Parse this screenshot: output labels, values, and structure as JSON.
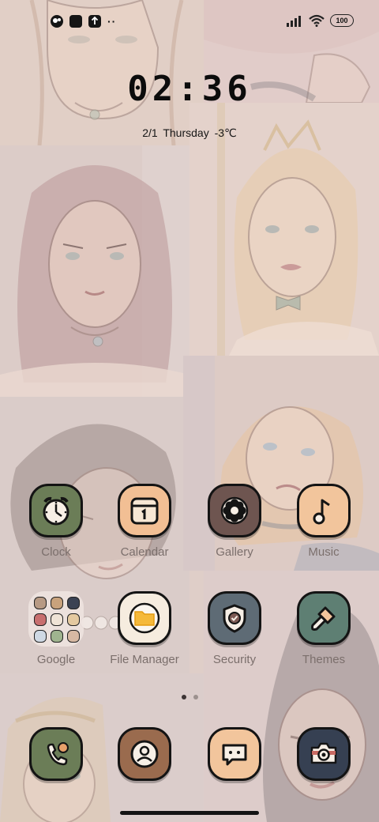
{
  "status_bar": {
    "left_icons": [
      "notification-icon",
      "square-icon",
      "upload-icon",
      "more-icon"
    ],
    "more_text": "··",
    "battery": "100",
    "right_icons": [
      "signal-icon",
      "wifi-icon",
      "battery-icon"
    ]
  },
  "clock": {
    "time": "02:36",
    "date": "2/1  Thursday   -3℃"
  },
  "apps": {
    "clock": {
      "label": "Clock",
      "icon": "alarm-clock-icon",
      "color": "#6b7d57"
    },
    "calendar": {
      "label": "Calendar",
      "icon": "calendar-icon",
      "color": "#f2bf94"
    },
    "gallery": {
      "label": "Gallery",
      "icon": "flower-icon",
      "color": "#6e5550"
    },
    "music": {
      "label": "Music",
      "icon": "music-note-icon",
      "color": "#f2c59c"
    },
    "google": {
      "label": "Google",
      "icon": "folder-icon"
    },
    "file_manager": {
      "label": "File Manager",
      "icon": "folder-icon",
      "color": "#f6ecdf"
    },
    "security": {
      "label": "Security",
      "icon": "shield-check-icon",
      "color": "#5e6b75"
    },
    "themes": {
      "label": "Themes",
      "icon": "paintbrush-icon",
      "color": "#5e7f73"
    }
  },
  "dock": {
    "phone": {
      "icon": "phone-icon",
      "color": "#6b7d57"
    },
    "contacts": {
      "icon": "contacts-icon",
      "color": "#9a6b4e"
    },
    "messages": {
      "icon": "message-icon",
      "color": "#f2c59c"
    },
    "camera": {
      "icon": "camera-icon",
      "color": "#364052"
    }
  },
  "page_indicator": {
    "pages": 2,
    "current": 1
  }
}
